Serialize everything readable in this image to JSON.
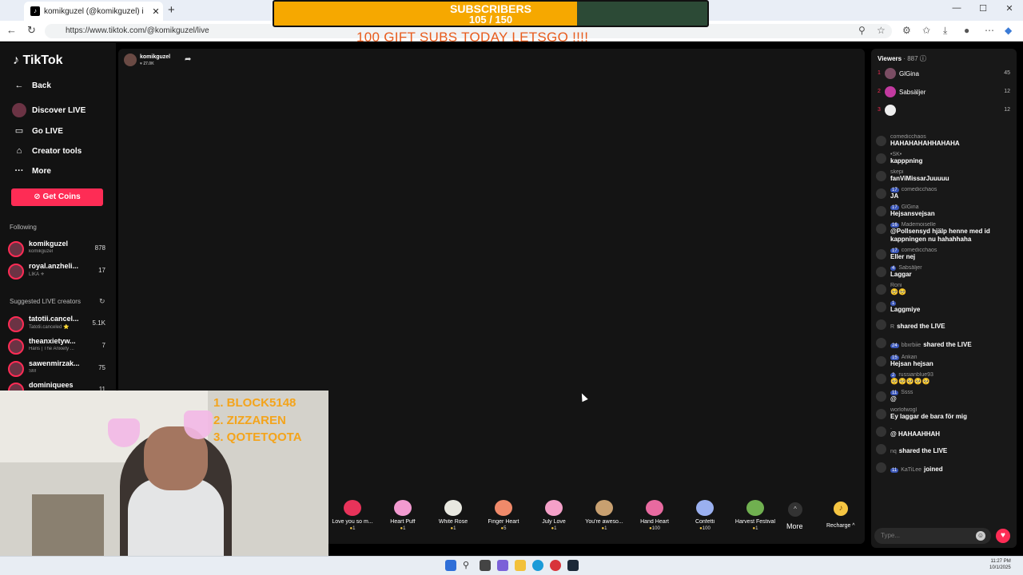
{
  "browser": {
    "tab_title": "komikguzel (@komikguzel) i",
    "url": "https://www.tiktok.com/@komikguzel/live"
  },
  "overlay": {
    "subs_title": "SUBSCRIBERS",
    "subs_count": "105 / 150",
    "subs_progress": 0.7,
    "goal_text": "100 GIFT SUBS TODAY LETSGO !!!!",
    "rank_lines": [
      "1. BLOCK5148",
      "2. ZIZZAREN",
      "3. QOTETQOTA"
    ]
  },
  "sidebar": {
    "logo": "TikTok",
    "back": "Back",
    "nav": [
      "Discover LIVE",
      "Go LIVE",
      "Creator tools",
      "More"
    ],
    "get_coins": "Get Coins",
    "following_title": "Following",
    "following": [
      {
        "name": "komikguzel",
        "sub": "komikguzel",
        "count": "878"
      },
      {
        "name": "royal.anzheli...",
        "sub": "LIKA ⚜",
        "count": "17"
      }
    ],
    "suggested_title": "Suggested LIVE creators",
    "suggested": [
      {
        "name": "tatotii.cancel...",
        "sub": "Tatotii.canceled ⭐",
        "count": "5.1K"
      },
      {
        "name": "theanxietyw...",
        "sub": "Haris | The Anxiety ...",
        "count": "7"
      },
      {
        "name": "sawenmirzak...",
        "sub": "SM",
        "count": "75"
      },
      {
        "name": "dominiquees",
        "sub": "",
        "count": "11"
      }
    ]
  },
  "stream": {
    "streamer_name": "komikguzel",
    "likes": "♥ 27.0K"
  },
  "gifts": [
    {
      "name": "Love you so m...",
      "price": "1",
      "color": "#e8335a"
    },
    {
      "name": "Heart Puff",
      "price": "1",
      "color": "#f29ad0"
    },
    {
      "name": "White Rose",
      "price": "1",
      "color": "#e8e8e0"
    },
    {
      "name": "Finger Heart",
      "price": "5",
      "color": "#f08a6a"
    },
    {
      "name": "July Love",
      "price": "1",
      "color": "#f4a0c8"
    },
    {
      "name": "You're aweso...",
      "price": "1",
      "color": "#c8a070"
    },
    {
      "name": "Hand Heart",
      "price": "100",
      "color": "#e86aa0"
    },
    {
      "name": "Confetti",
      "price": "100",
      "color": "#9ab0f0"
    },
    {
      "name": "Harvest Festival",
      "price": "1",
      "color": "#70b050"
    }
  ],
  "gift_more": "More",
  "recharge": "Recharge",
  "viewers": {
    "label": "Viewers",
    "count": "· 887"
  },
  "ranking": [
    {
      "rank": "1",
      "name": "GlGina",
      "score": "45"
    },
    {
      "rank": "2",
      "name": "Sabsäljer",
      "score": "12"
    },
    {
      "rank": "3",
      "name": "",
      "score": "12"
    }
  ],
  "chat": [
    {
      "user": "comedicchaos",
      "badge": "",
      "text": "HAHAHAHAHHAHAHA"
    },
    {
      "user": "•SK•",
      "badge": "",
      "text": "kapppning"
    },
    {
      "user": "skepi",
      "badge": "",
      "text": "fanViMissarJuuuuu"
    },
    {
      "user": "comedicchaos",
      "badge": "17",
      "text": "JA"
    },
    {
      "user": "GlGina",
      "badge": "17",
      "text": "Hejsansvejsan"
    },
    {
      "user": "Mademoiselle",
      "badge": "16",
      "text": "@Pollsensyd hjälp henne med id kappningen nu hahahhaha"
    },
    {
      "user": "comedicchaos",
      "badge": "17",
      "text": "Eller nej"
    },
    {
      "user": "Sabsäljer",
      "badge": "4",
      "text": "Laggar"
    },
    {
      "user": "Roni",
      "badge": "",
      "text": "🥺🥺"
    },
    {
      "user": "",
      "badge": "1",
      "text": "Laggmiye"
    },
    {
      "user": "R",
      "badge": "",
      "text": "shared the LIVE",
      "share": true
    },
    {
      "user": "bbxrbiie",
      "badge": "24",
      "text": "shared the LIVE",
      "share": true
    },
    {
      "user": "Ankan",
      "badge": "15",
      "text": "Hejsan hejsan"
    },
    {
      "user": "russianblue93",
      "badge": "2",
      "text": "🥺🥺🥺🥺🥺"
    },
    {
      "user": "Ssss",
      "badge": "11",
      "text": "@"
    },
    {
      "user": "worlofwogl",
      "badge": "",
      "text": "Ey laggar de bara för mig"
    },
    {
      "user": ".",
      "badge": "",
      "text": "@ HAHAAHHAH"
    },
    {
      "user": "nq",
      "badge": "",
      "text": "shared the LIVE",
      "share": true
    },
    {
      "user": "KaTiLee",
      "badge": "11",
      "text": "joined",
      "share": true
    }
  ],
  "chat_placeholder": "Type...",
  "clock": {
    "time": "11:27 PM",
    "date": "10/1/2025"
  }
}
